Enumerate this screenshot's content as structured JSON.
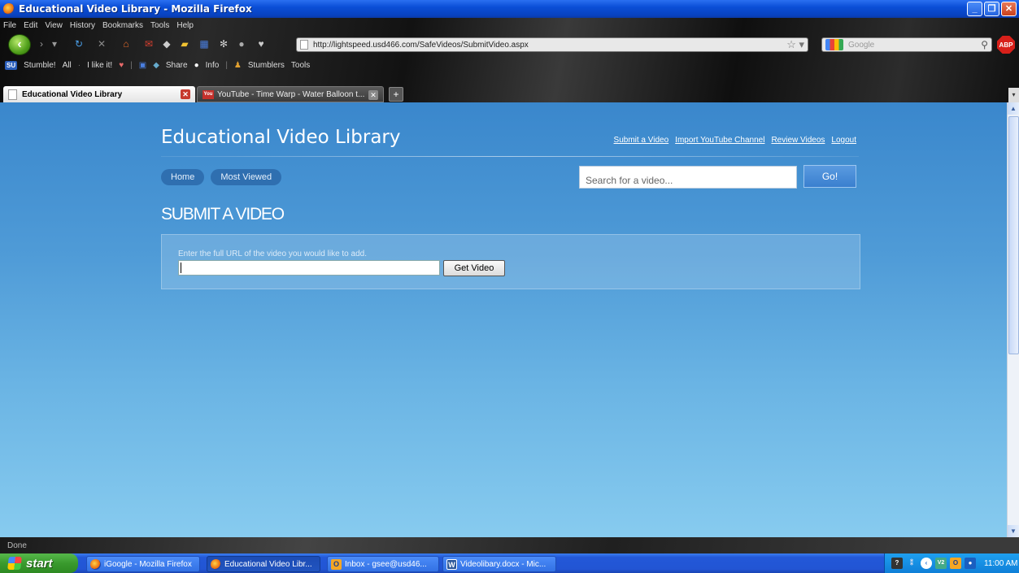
{
  "window": {
    "title": "Educational Video Library - Mozilla Firefox"
  },
  "menu": [
    "File",
    "Edit",
    "View",
    "History",
    "Bookmarks",
    "Tools",
    "Help"
  ],
  "address_bar": {
    "url": "http://lightspeed.usd466.com/SafeVideos/SubmitVideo.aspx"
  },
  "search_bar": {
    "placeholder": "Google"
  },
  "toolbar": {
    "adblock": "ABP"
  },
  "stumble_toolbar": {
    "stumble": "Stumble!",
    "all": "All",
    "i_like_it": "I like it!",
    "share": "Share",
    "info": "Info",
    "stumblers": "Stumblers",
    "tools": "Tools"
  },
  "tabs": [
    {
      "label": "Educational Video Library",
      "active": true
    },
    {
      "label": "YouTube - Time Warp - Water Balloon t...",
      "active": false
    }
  ],
  "site": {
    "title": "Educational Video Library",
    "top_links": [
      "Submit a Video",
      "Import YouTube Channel",
      "Review Videos",
      "Logout"
    ],
    "nav": [
      "Home",
      "Most Viewed"
    ],
    "search": {
      "placeholder": "Search for a video...",
      "button": "Go!"
    },
    "heading": "SUBMIT A VIDEO",
    "form": {
      "hint": "Enter the full URL of the video you would like to add.",
      "url_value": "",
      "button": "Get Video"
    }
  },
  "status": {
    "text": "Done"
  },
  "taskbar": {
    "start": "start",
    "items": [
      {
        "label": "iGoogle - Mozilla Firefox",
        "active": false
      },
      {
        "label": "Educational Video Libr...",
        "active": true
      },
      {
        "label": "Inbox - gsee@usd46...",
        "active": false
      },
      {
        "label": "Videolibary.docx - Mic...",
        "active": false
      }
    ],
    "clock": "11:00 AM"
  },
  "colors": {
    "page_bg_top": "#3a87cc",
    "page_bg_bottom": "#87cbef",
    "pill": "#2f6fb0",
    "taskbar": "#2358d8",
    "start": "#3a9a2e"
  }
}
